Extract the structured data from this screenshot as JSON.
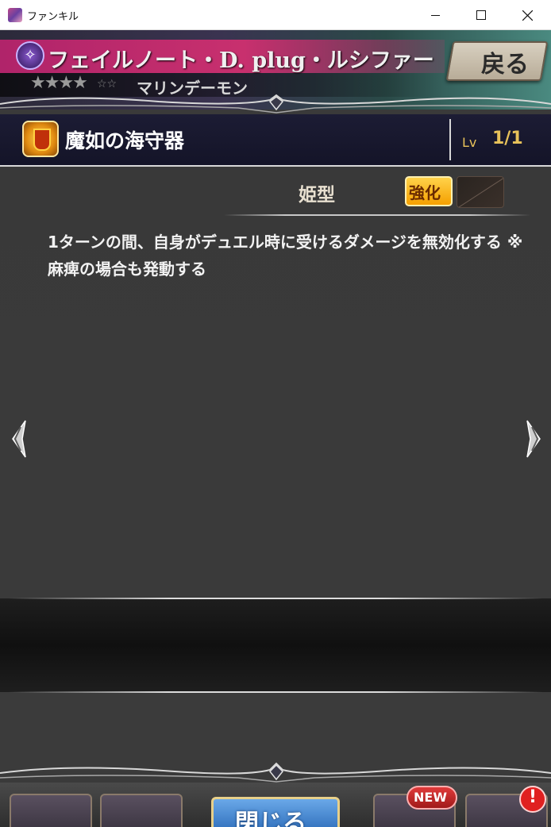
{
  "window": {
    "title": "ファンキル"
  },
  "header": {
    "class_icon": "star-glyph-icon",
    "character_name": "フェイルノート・D. plug・ルシファー",
    "rarity_stars": "★★★★",
    "rarity_extra": "☆☆",
    "character_type": "マリンデーモン",
    "back_label": "戻る"
  },
  "skill": {
    "name": "魔如の海守器",
    "lv_label": "Lv",
    "lv_value": "1/1",
    "type": "姫型",
    "enhance_label": "強化",
    "description": "1ターンの間、自身がデュエル時に受けるダメージを無効化する ※麻痺の場合も発動する"
  },
  "bottom_menu": {
    "close_label": "閉じる",
    "new_badge": "NEW",
    "alert_badge": "!"
  },
  "colors": {
    "ribbon": "#c8306e",
    "gold_text": "#e8c25a",
    "enhance_badge": "#f5a000",
    "close_button": "#2a6ab8"
  }
}
